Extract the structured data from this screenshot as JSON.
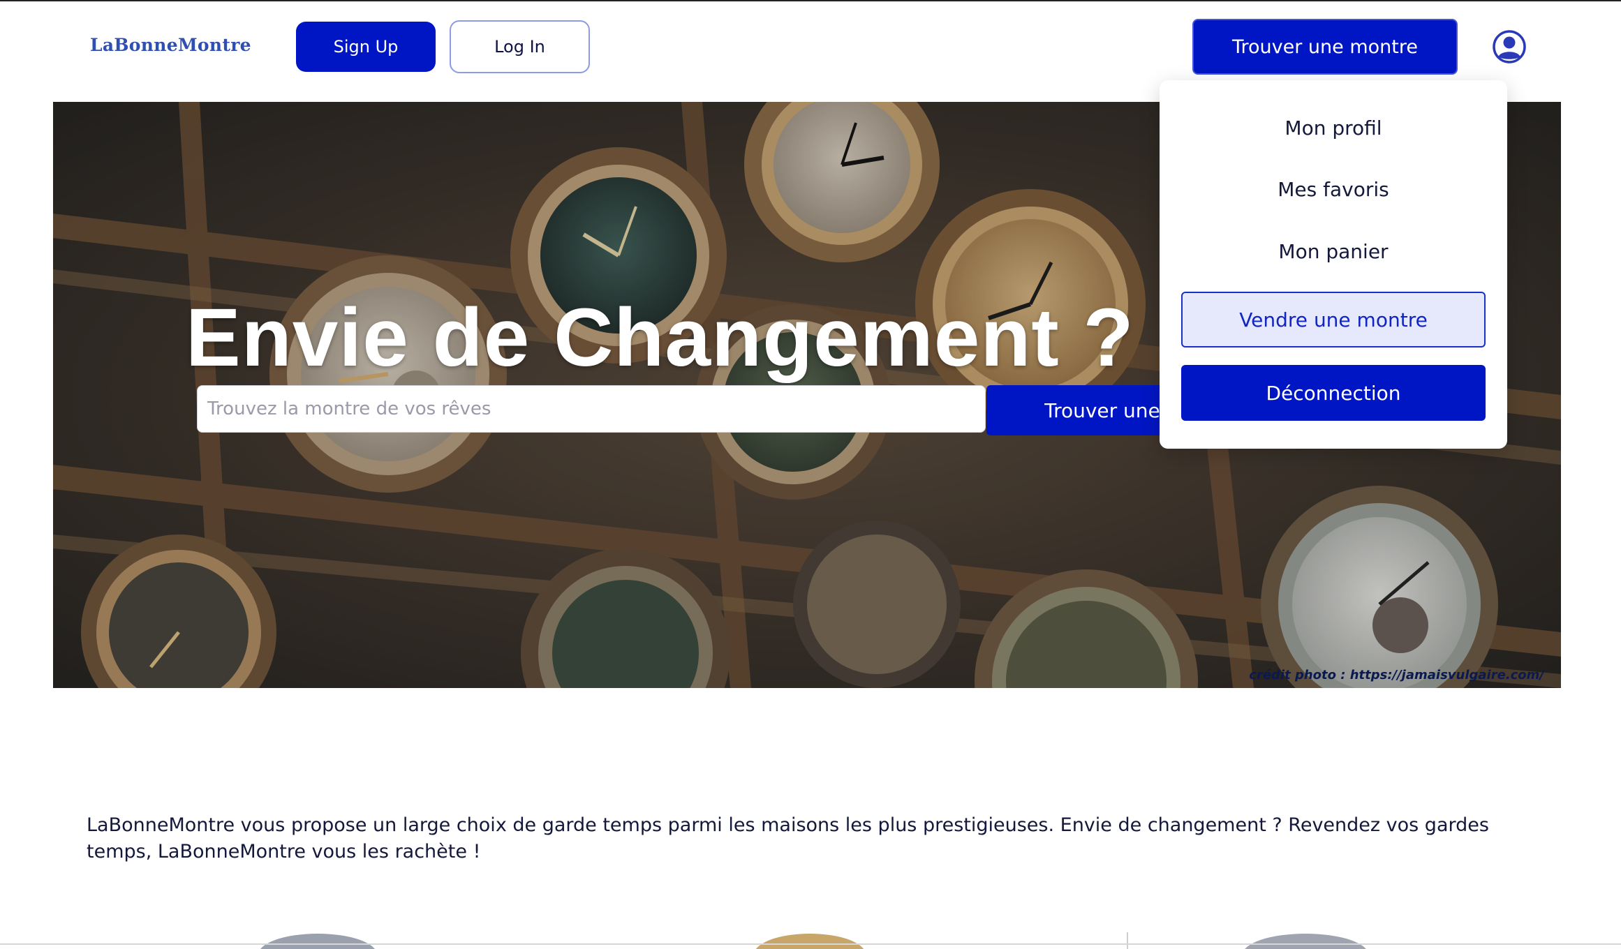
{
  "header": {
    "logo": "LaBonneMontre",
    "signup_label": "Sign Up",
    "login_label": "Log In",
    "find_button_label": "Trouver une montre"
  },
  "dropdown": {
    "items": [
      {
        "label": "Mon profil"
      },
      {
        "label": "Mes favoris"
      },
      {
        "label": "Mon panier"
      },
      {
        "label": "Vendre une montre"
      },
      {
        "label": "Déconnection"
      }
    ]
  },
  "hero": {
    "title": "Envie de Changement ?",
    "search_placeholder": "Trouvez la montre de vos rêves",
    "search_button_label": "Trouver une montre",
    "credit": "crédit photo : https://jamaisvulgaire.com/"
  },
  "intro": {
    "text": "LaBonneMontre vous propose un large choix de garde temps parmi les maisons les plus prestigieuses. Envie de changement ? Revendez vos gardes temps, LaBonneMontre vous les rachète !"
  },
  "colors": {
    "accent": "#0016c4",
    "logo": "#2f50b0",
    "text": "#14183a"
  },
  "icons": {
    "avatar": "user-circle-icon"
  }
}
